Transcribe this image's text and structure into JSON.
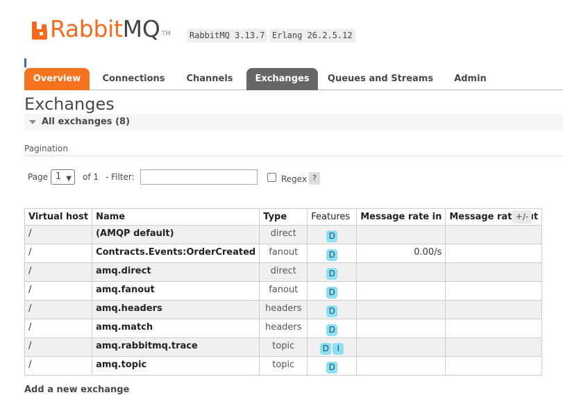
{
  "header": {
    "logo_rabbit": "Rabbit",
    "logo_mq": "MQ",
    "logo_tm": "TM",
    "version": "RabbitMQ 3.13.7",
    "erlang": "Erlang 26.2.5.12"
  },
  "tabs": [
    {
      "label": "Overview"
    },
    {
      "label": "Connections"
    },
    {
      "label": "Channels"
    },
    {
      "label": "Exchanges"
    },
    {
      "label": "Queues and Streams"
    },
    {
      "label": "Admin"
    }
  ],
  "page_title": "Exchanges",
  "section": {
    "label": "All exchanges (8)"
  },
  "pagination": {
    "label": "Pagination",
    "page_label": "Page",
    "page_value": "1",
    "of_label": "of 1",
    "filter_label": "- Filter:",
    "filter_value": "",
    "regex_label": "Regex",
    "help": "?"
  },
  "table": {
    "headers": [
      "Virtual host",
      "Name",
      "Type",
      "Features",
      "Message rate in",
      "Message rate out"
    ],
    "toggle": "+/-",
    "rows": [
      {
        "vhost": "/",
        "name": "(AMQP default)",
        "type": "direct",
        "features": [
          "D"
        ],
        "rate_in": "",
        "rate_out": ""
      },
      {
        "vhost": "/",
        "name": "Contracts.Events:OrderCreated",
        "type": "fanout",
        "features": [
          "D"
        ],
        "rate_in": "0.00/s",
        "rate_out": ""
      },
      {
        "vhost": "/",
        "name": "amq.direct",
        "type": "direct",
        "features": [
          "D"
        ],
        "rate_in": "",
        "rate_out": ""
      },
      {
        "vhost": "/",
        "name": "amq.fanout",
        "type": "fanout",
        "features": [
          "D"
        ],
        "rate_in": "",
        "rate_out": ""
      },
      {
        "vhost": "/",
        "name": "amq.headers",
        "type": "headers",
        "features": [
          "D"
        ],
        "rate_in": "",
        "rate_out": ""
      },
      {
        "vhost": "/",
        "name": "amq.match",
        "type": "headers",
        "features": [
          "D"
        ],
        "rate_in": "",
        "rate_out": ""
      },
      {
        "vhost": "/",
        "name": "amq.rabbitmq.trace",
        "type": "topic",
        "features": [
          "D",
          "I"
        ],
        "rate_in": "",
        "rate_out": ""
      },
      {
        "vhost": "/",
        "name": "amq.topic",
        "type": "topic",
        "features": [
          "D"
        ],
        "rate_in": "",
        "rate_out": ""
      }
    ]
  },
  "next_section": "Add a new exchange",
  "colors": {
    "accent": "#f5731f",
    "active_tab": "#666666",
    "badge": "#8de0f0"
  }
}
